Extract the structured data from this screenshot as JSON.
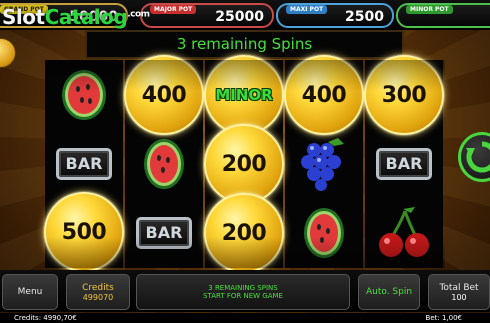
{
  "watermark": {
    "brand_a": "Slot",
    "brand_b": "Catalog",
    "brand_ext": ".com"
  },
  "jackpots": [
    {
      "label": "GRAND POT",
      "value": "50000"
    },
    {
      "label": "MAJOR POT",
      "value": "25000"
    },
    {
      "label": "MAXI POT",
      "value": "2500"
    },
    {
      "label": "MINOR POT",
      "value": ""
    }
  ],
  "banner": {
    "text": "3  remaining Spins"
  },
  "reels": {
    "symbols": [
      [
        "watermelon",
        "bar",
        "coin"
      ],
      [
        "coin",
        "watermelon",
        "bar"
      ],
      [
        "coin",
        "coin",
        "coin"
      ],
      [
        "coin",
        "grapes",
        "watermelon"
      ],
      [
        "coin",
        "bar",
        "cherries"
      ]
    ],
    "bar_label": "BAR",
    "coins": [
      {
        "value": "500"
      },
      {
        "value": "400"
      },
      {
        "value": "MINOR"
      },
      {
        "value": "200"
      },
      {
        "value": "200"
      },
      {
        "value": "400"
      },
      {
        "value": "300"
      }
    ]
  },
  "controls": {
    "menu": "Menu",
    "credits_label": "Credits",
    "credits_value": "499070",
    "message_line1": "3 REMAINING SPINS",
    "message_line2": "START FOR NEW GAME",
    "auto_spin": "Auto. Spin",
    "total_bet_label": "Total Bet",
    "total_bet_value": "100"
  },
  "status": {
    "credits": "Credits: 4990,70€",
    "bet": "Bet: 1,00€"
  },
  "colors": {
    "accent_green": "#45e13a",
    "coin_gold": "#ffd93a",
    "bezel": "#c8a03a"
  }
}
